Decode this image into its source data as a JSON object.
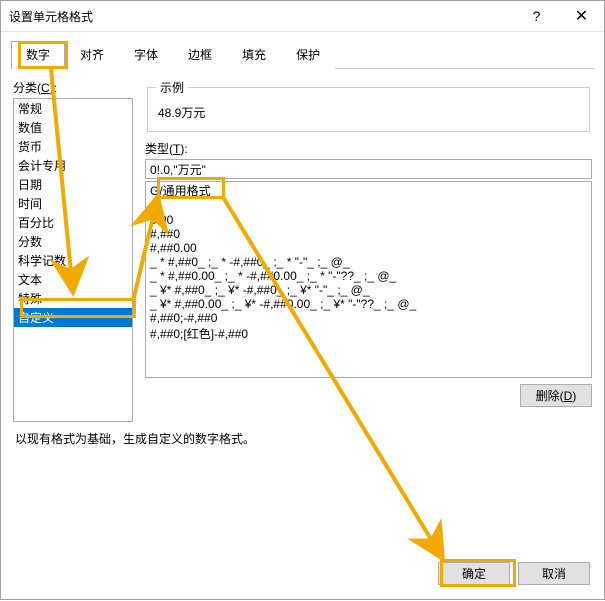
{
  "window": {
    "title": "设置单元格格式"
  },
  "tabs": [
    {
      "label": "数字",
      "active": true
    },
    {
      "label": "对齐"
    },
    {
      "label": "字体"
    },
    {
      "label": "边框"
    },
    {
      "label": "填充"
    },
    {
      "label": "保护"
    }
  ],
  "category": {
    "label_prefix": "分类(",
    "label_key": "C",
    "label_suffix": "):",
    "items": [
      "常规",
      "数值",
      "货币",
      "会计专用",
      "日期",
      "时间",
      "百分比",
      "分数",
      "科学记数",
      "文本",
      "特殊",
      "自定义"
    ],
    "selected": "自定义"
  },
  "sample": {
    "legend": "示例",
    "value": "48.9万元"
  },
  "type": {
    "label_prefix": "类型(",
    "label_key": "T",
    "label_suffix": "):",
    "value": "0!.0,\"万元\"",
    "list": [
      "G/通用格式",
      "0",
      "0.00",
      "#,##0",
      "#,##0.00",
      "_ * #,##0_ ;_ * -#,##0_ ;_ * \"-\"_ ;_ @_ ",
      "_ * #,##0.00_ ;_ * -#,##0.00_ ;_ * \"-\"??_ ;_ @_ ",
      "_ ¥* #,##0_ ;_ ¥* -#,##0_ ;_ ¥* \"-\"_ ;_ @_ ",
      "_ ¥* #,##0.00_ ;_ ¥* -#,##0.00_ ;_ ¥* \"-\"??_ ;_ @_ ",
      "#,##0;-#,##0",
      "#,##0;[红色]-#,##0"
    ]
  },
  "buttons": {
    "delete_prefix": "删除(",
    "delete_key": "D",
    "delete_suffix": ")",
    "ok": "确定",
    "cancel": "取消"
  },
  "hint": "以现有格式为基础，生成自定义的数字格式。"
}
